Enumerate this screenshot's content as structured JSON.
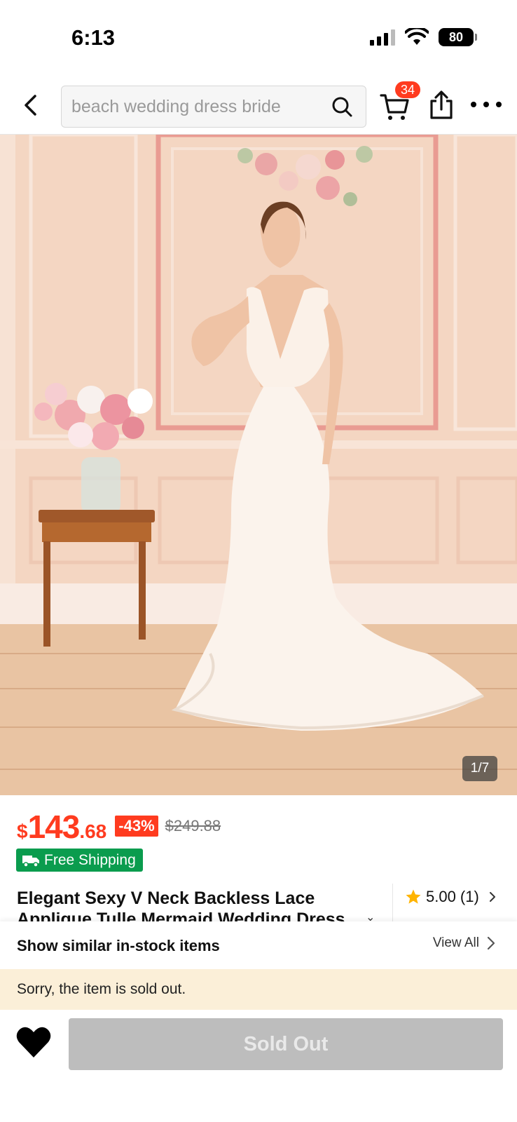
{
  "status_bar": {
    "time": "6:13",
    "battery": "80",
    "icons": [
      "signal-icon",
      "wifi-icon",
      "battery-icon"
    ]
  },
  "header": {
    "search_placeholder": "beach wedding dress bride",
    "cart_count": "34",
    "icons": [
      "back-icon",
      "search-icon",
      "cart-icon",
      "share-icon",
      "more-icon"
    ]
  },
  "product_image": {
    "counter": "1/7"
  },
  "product": {
    "price_currency": "$",
    "price_int": "143",
    "price_dec": ".68",
    "discount": "-43%",
    "original_price": "$249.88",
    "shipping_label": "Free Shipping",
    "title": "Elegant Sexy V Neck Backless Lace Applique Tulle Mermaid Wedding Dress",
    "rating": "5.00 (1)"
  },
  "similar": {
    "label": "Show similar in-stock items",
    "view_all": "View All"
  },
  "notice": {
    "text": "Sorry, the item is sold out."
  },
  "action_bar": {
    "button_label": "Sold Out"
  },
  "colors": {
    "price": "#ff3b1f",
    "shipping_badge": "#0a9c4e",
    "notice_bg": "#fbefd8",
    "disabled_button": "#bdbdbd"
  }
}
